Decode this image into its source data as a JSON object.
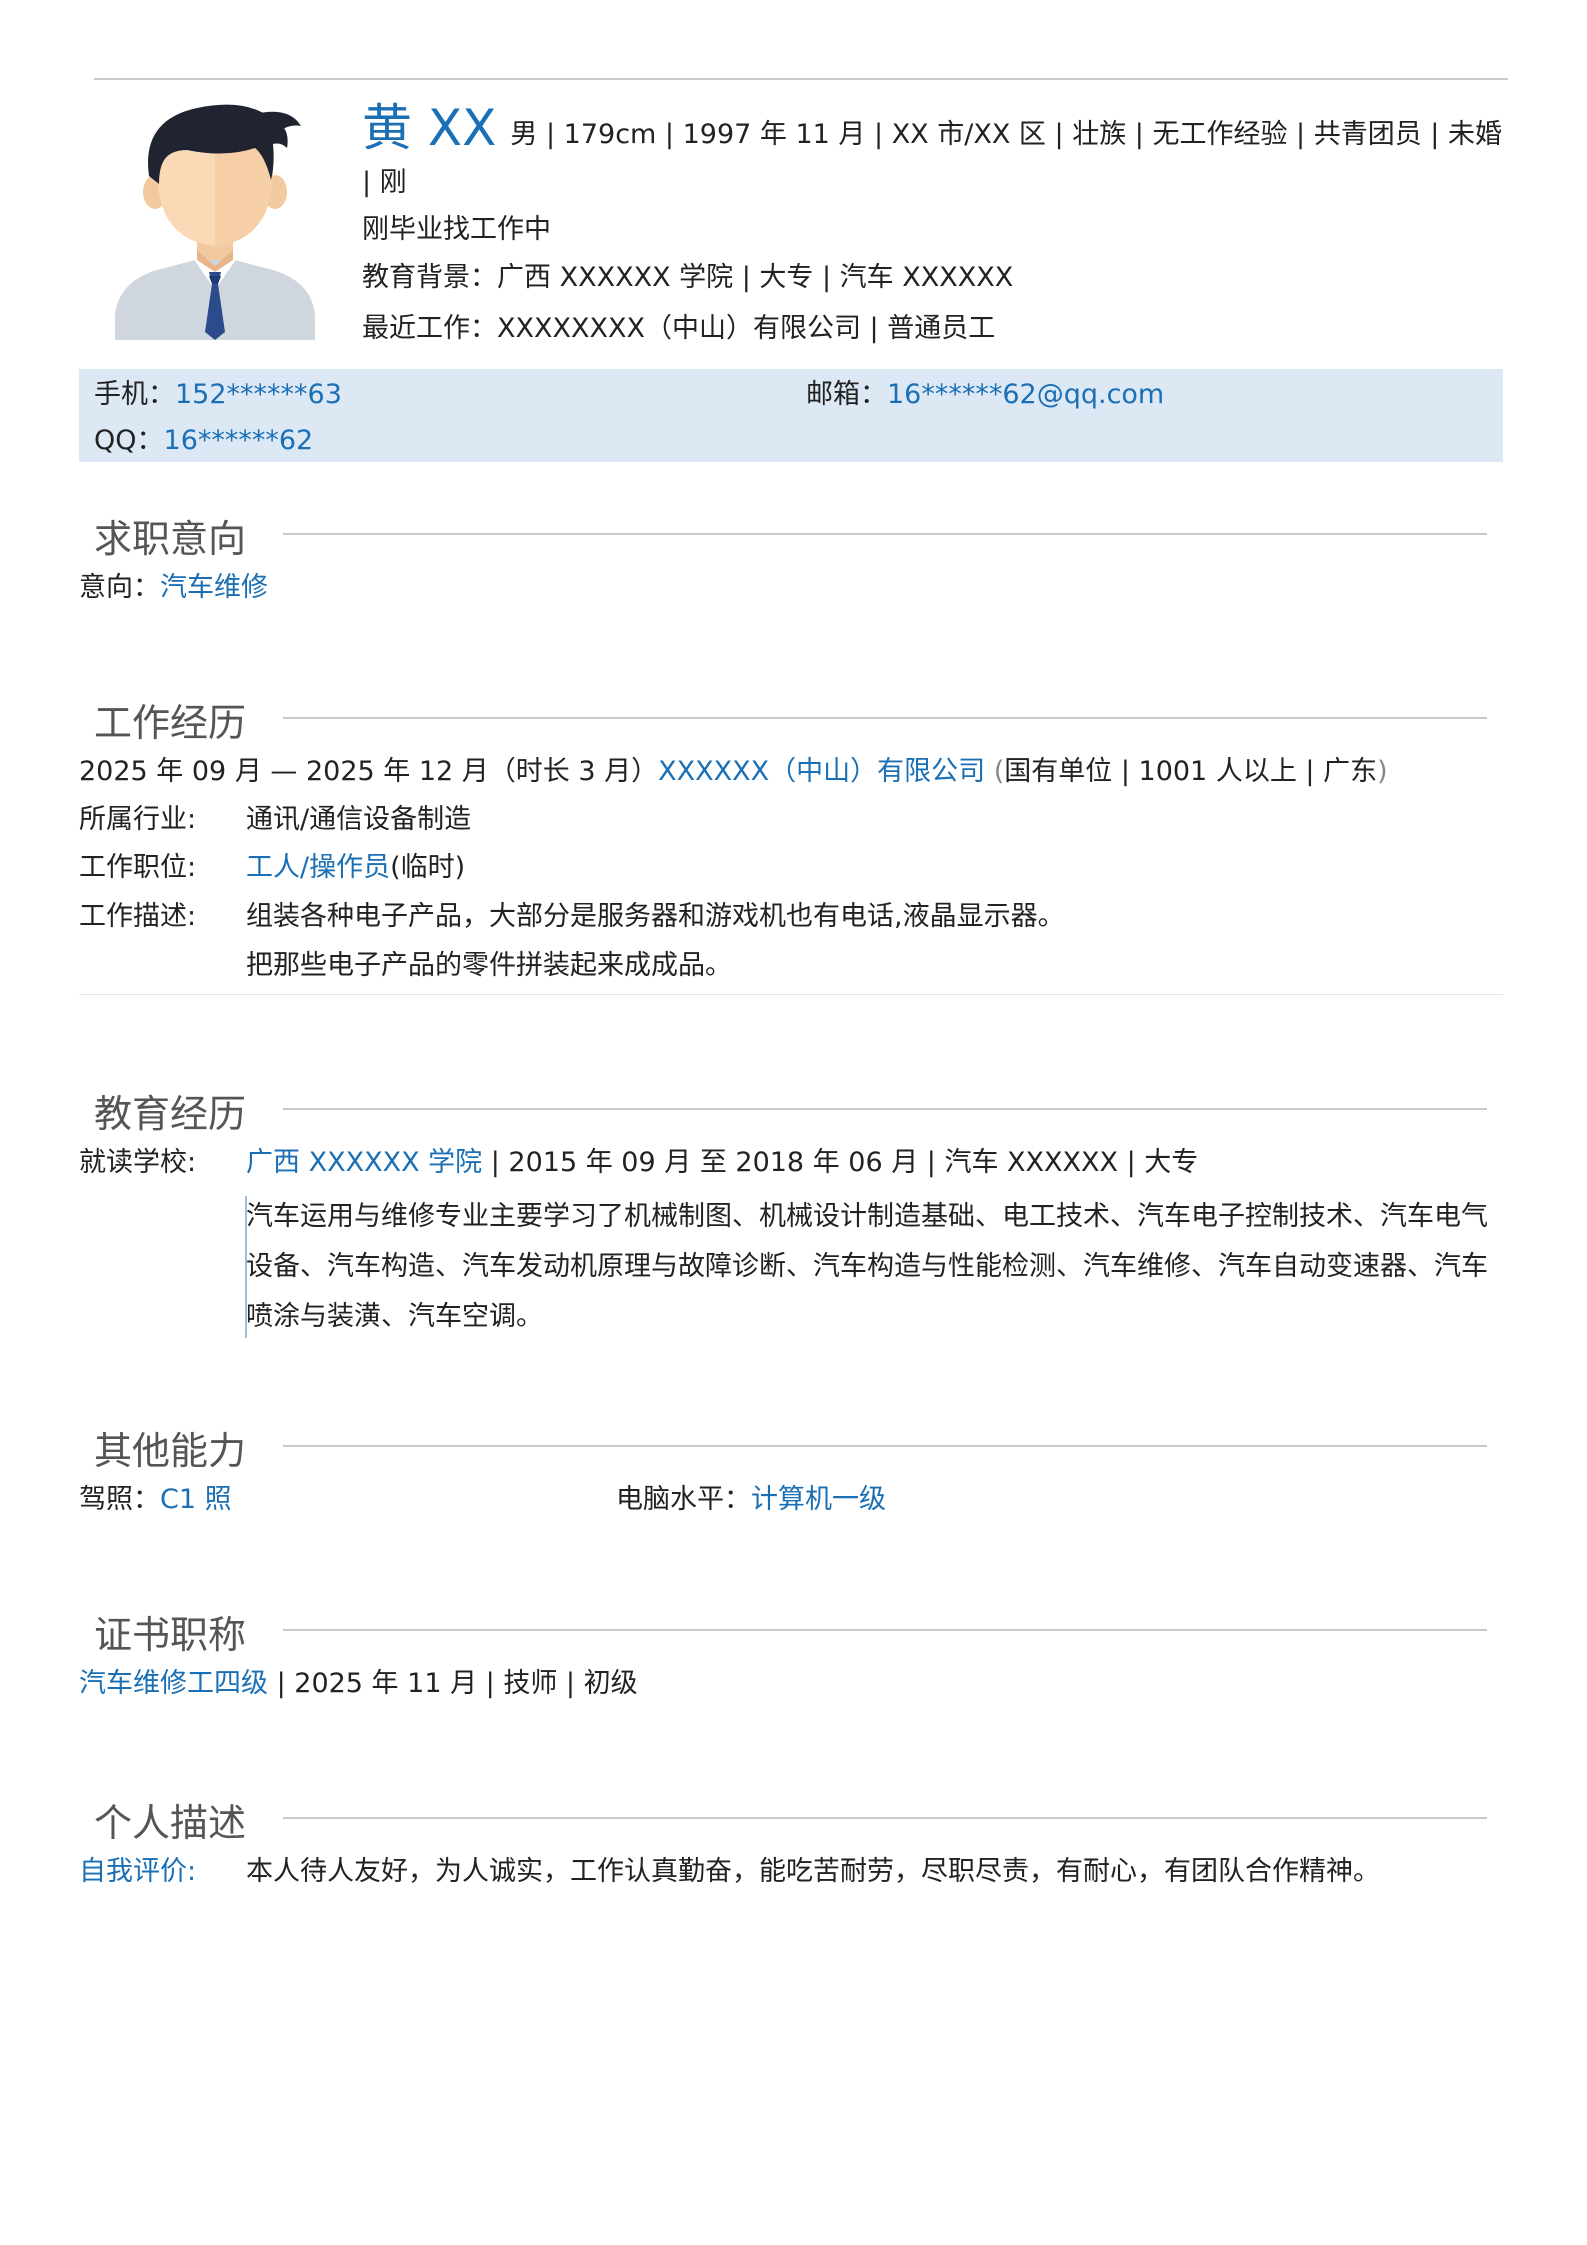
{
  "header": {
    "name": "黄 XX",
    "summary_line1": "男 | 179cm | 1997 年 11 月 | XX 市/XX 区 | 壮族 | 无工作经验 | 共青团员 | 未婚 | 刚",
    "summary_line2": "刚毕业找工作中",
    "education_label": "教育背景：",
    "education_value": "广西 XXXXXX 学院 | 大专 | 汽车 XXXXXX",
    "recent_work_label": "最近工作：",
    "recent_work_value": "XXXXXXXX（中山）有限公司 | 普通员工"
  },
  "contact": {
    "phone_label": "手机：",
    "phone_value": "152******63",
    "email_label": "邮箱：",
    "email_value": "16******62@qq.com",
    "qq_label": "QQ：",
    "qq_value": "16******62"
  },
  "sections": {
    "intent": {
      "title": "求职意向",
      "label": "意向：",
      "value": "汽车维修"
    },
    "work": {
      "title": "工作经历",
      "period": "2025 年 09 月 — 2025 年 12 月（时长 3 月）",
      "company": "XXXXXX（中山）有限公司",
      "company_meta_open": " (",
      "company_meta": "国有单位 | 1001 人以上 | 广东",
      "company_meta_close": ")",
      "industry_label": "所属行业:",
      "industry_value": "通讯/通信设备制造",
      "position_label": "工作职位:",
      "position_value": "工人/操作员",
      "position_note": "(临时)",
      "desc_label": "工作描述:",
      "desc_line1": "组装各种电子产品，大部分是服务器和游戏机也有电话,液晶显示器。",
      "desc_line2": "把那些电子产品的零件拼装起来成成品。"
    },
    "education": {
      "title": "教育经历",
      "school_label": "就读学校:",
      "school": "广西 XXXXXX 学院",
      "school_meta": " | 2015 年 09 月 至 2018 年 06 月 | 汽车 XXXXXX | 大专",
      "description": "汽车运用与维修专业主要学习了机械制图、机械设计制造基础、电工技术、汽车电子控制技术、汽车电气设备、汽车构造、汽车发动机原理与故障诊断、汽车构造与性能检测、汽车维修、汽车自动变速器、汽车喷涂与装潢、汽车空调。"
    },
    "skills": {
      "title": "其他能力",
      "license_label": "驾照：",
      "license_value": "C1 照",
      "computer_label": "电脑水平：",
      "computer_value": "计算机一级"
    },
    "certs": {
      "title": "证书职称",
      "name": "汽车维修工四级",
      "meta": " | 2025 年 11 月 | 技师 | 初级"
    },
    "personal": {
      "title": "个人描述",
      "label": "自我评价:",
      "value": "本人待人友好，为人诚实，工作认真勤奋，能吃苦耐劳，尽职尽责，有耐心，有团队合作精神。"
    }
  },
  "colors": {
    "accent": "#1a6fb5",
    "contact_bg": "#dde8f5",
    "rule": "#c9c9c9",
    "section_title": "#555555"
  },
  "icons": {
    "avatar": "male-avatar-icon"
  }
}
